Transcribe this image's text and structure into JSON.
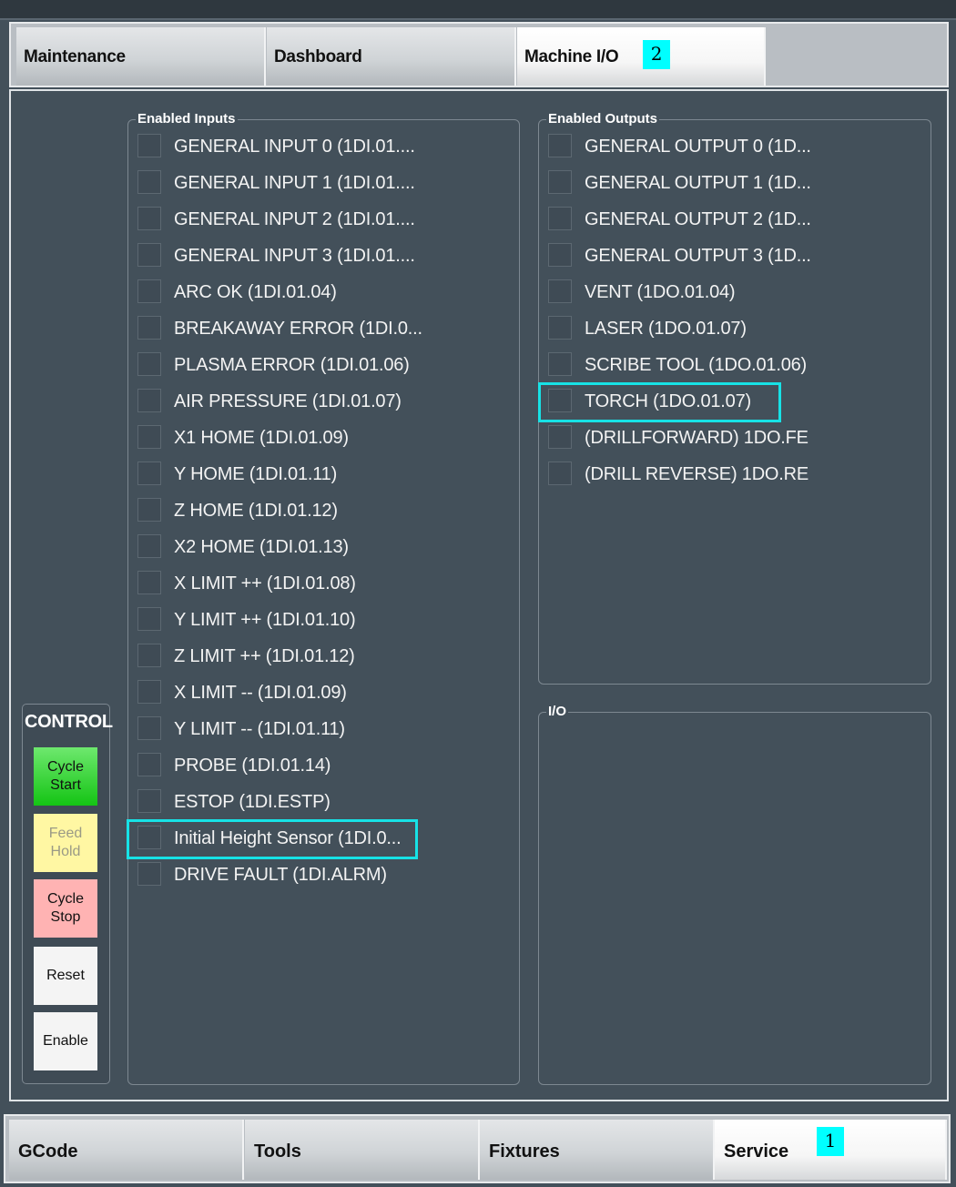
{
  "top_tabs": [
    {
      "label": "Maintenance"
    },
    {
      "label": "Dashboard"
    },
    {
      "label": "Machine I/O",
      "badge": "2"
    }
  ],
  "inputs": {
    "title": "Enabled Inputs",
    "items": [
      "GENERAL INPUT 0 (1DI.01....",
      "GENERAL INPUT 1 (1DI.01....",
      "GENERAL INPUT 2 (1DI.01....",
      "GENERAL INPUT 3 (1DI.01....",
      "ARC OK (1DI.01.04)",
      "BREAKAWAY ERROR (1DI.0...",
      "PLASMA ERROR (1DI.01.06)",
      "AIR PRESSURE (1DI.01.07)",
      "X1 HOME  (1DI.01.09)",
      "Y HOME  (1DI.01.11)",
      "Z  HOME  (1DI.01.12)",
      "X2 HOME  (1DI.01.13)",
      "X LIMIT ++ (1DI.01.08)",
      "Y LIMIT ++ (1DI.01.10)",
      "Z LIMIT ++ (1DI.01.12)",
      "X LIMIT -- (1DI.01.09)",
      "Y LIMIT -- (1DI.01.11)",
      "PROBE (1DI.01.14)",
      "ESTOP (1DI.ESTP)",
      "Initial Height Sensor (1DI.0...",
      "DRIVE FAULT (1DI.ALRM)"
    ]
  },
  "outputs": {
    "title": "Enabled Outputs",
    "items": [
      "GENERAL OUTPUT 0 (1D...",
      "GENERAL OUTPUT 1 (1D...",
      "GENERAL OUTPUT 2 (1D...",
      "GENERAL OUTPUT 3 (1D...",
      "VENT (1DO.01.04)",
      "LASER (1DO.01.07)",
      "SCRIBE TOOL (1DO.01.06)",
      "TORCH (1DO.01.07)",
      "(DRILLFORWARD) 1DO.FE",
      "(DRILL REVERSE) 1DO.RE"
    ]
  },
  "io_group": {
    "title": "I/O"
  },
  "control": {
    "title": "CONTROL",
    "buttons": [
      {
        "line1": "Cycle",
        "line2": "Start"
      },
      {
        "line1": "Feed",
        "line2": "Hold"
      },
      {
        "line1": "Cycle",
        "line2": "Stop"
      },
      {
        "line1": "Reset",
        "line2": ""
      },
      {
        "line1": "Enable",
        "line2": ""
      }
    ]
  },
  "bottom_tabs": [
    {
      "label": "GCode"
    },
    {
      "label": "Tools"
    },
    {
      "label": "Fixtures"
    },
    {
      "label": "Service",
      "badge": "1"
    }
  ],
  "colors": {
    "highlight": "#17e2e6",
    "badge": "#00ffff",
    "panel": "#43505a"
  }
}
